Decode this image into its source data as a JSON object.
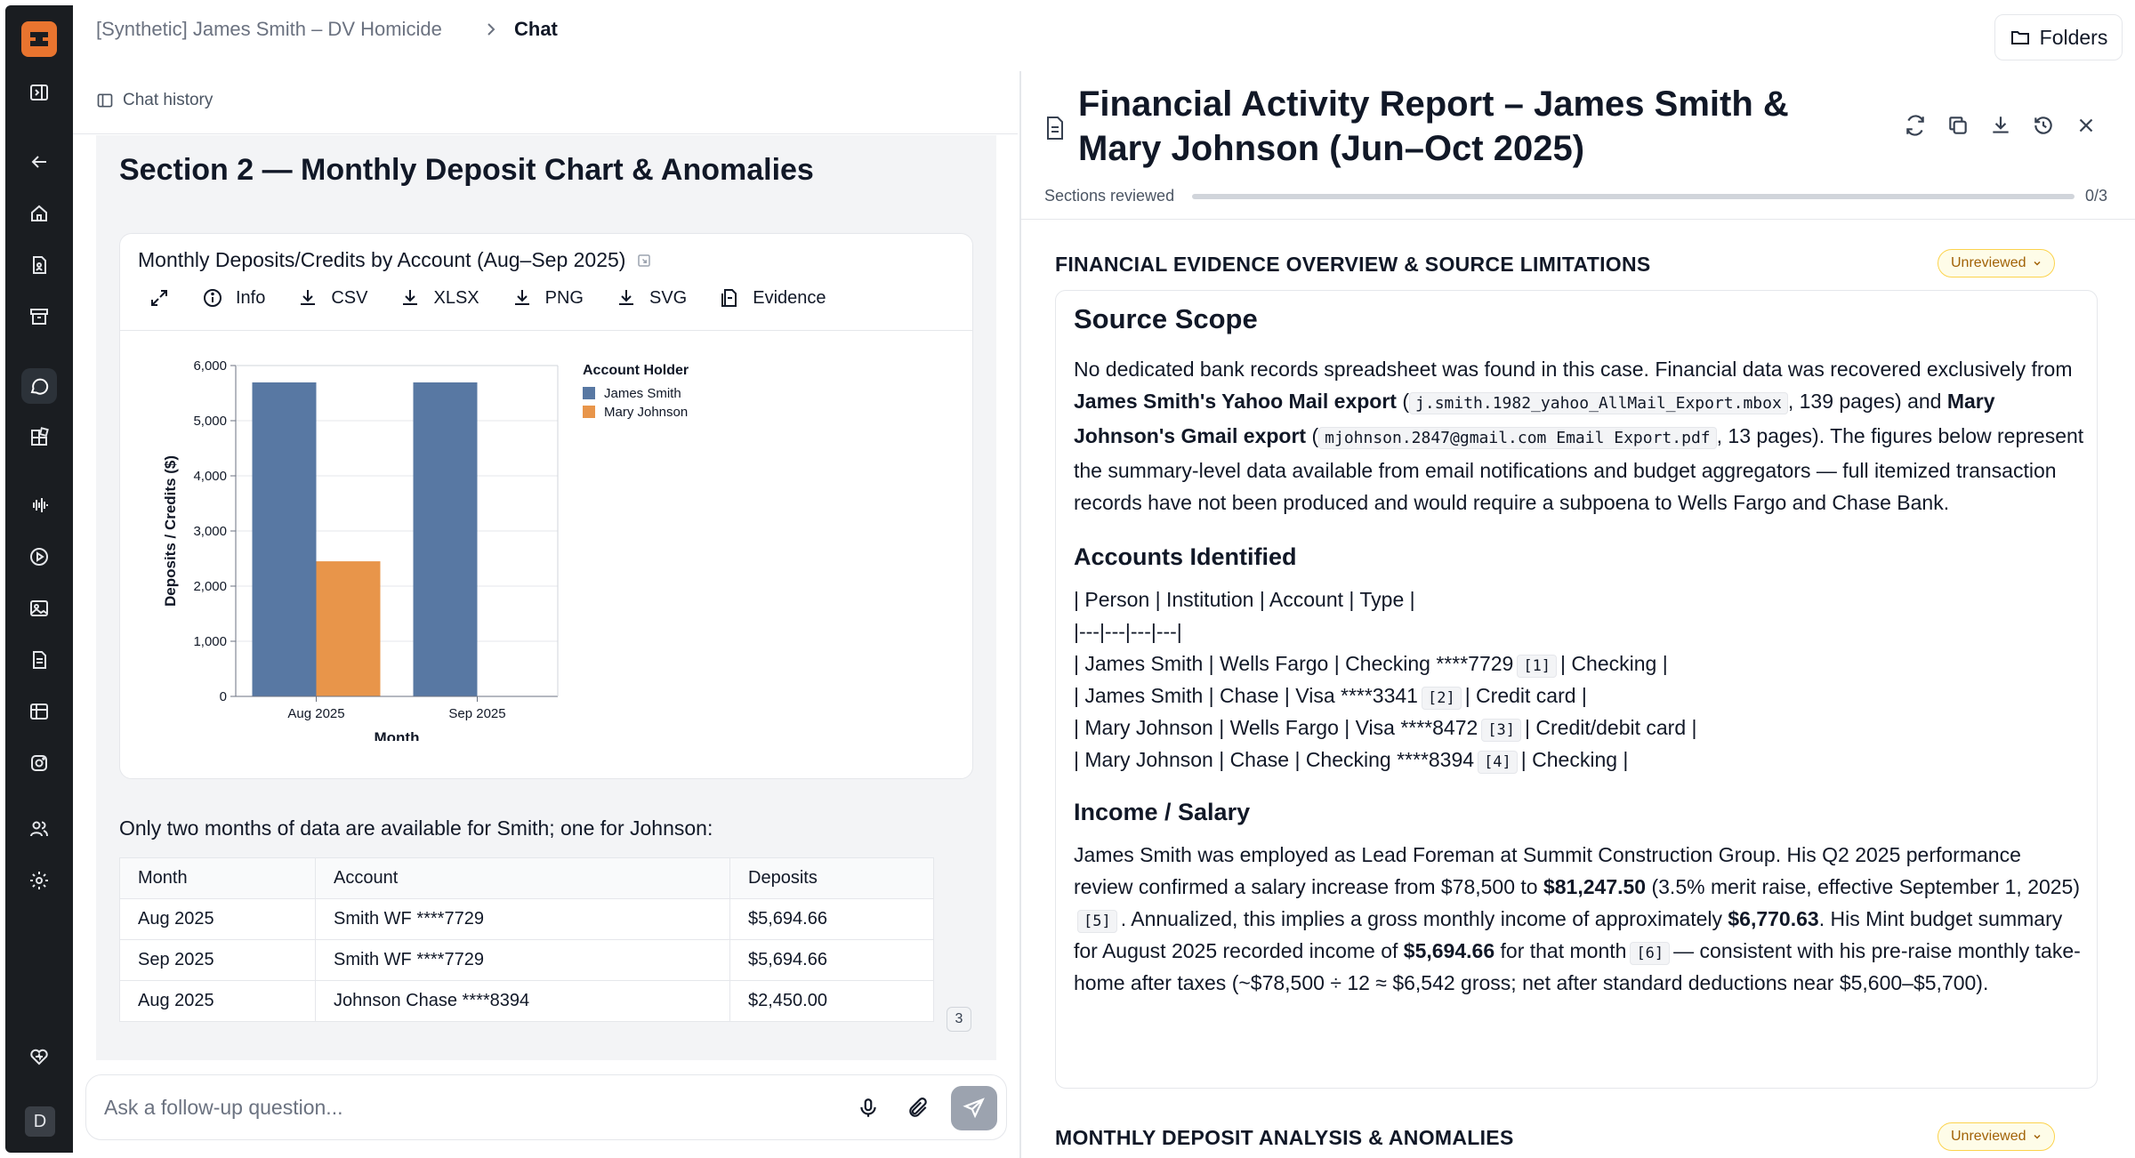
{
  "breadcrumb": {
    "case": "[Synthetic] James Smith – DV Homicide",
    "current": "Chat"
  },
  "header": {
    "folders_label": "Folders"
  },
  "chat": {
    "history_label": "Chat history",
    "section_title": "Section 2 — Monthly Deposit Chart & Anomalies",
    "chart_card": {
      "title": "Monthly Deposits/Credits by Account (Aug–Sep 2025)",
      "toolbar": {
        "info": "Info",
        "csv": "CSV",
        "xlsx": "XLSX",
        "png": "PNG",
        "svg": "SVG",
        "evidence": "Evidence"
      }
    },
    "caption": "Only two months of data are available for Smith; one for Johnson:",
    "table": {
      "headers": [
        "Month",
        "Account",
        "Deposits"
      ],
      "rows": [
        [
          "Aug 2025",
          "Smith WF ****7729",
          "$5,694.66"
        ],
        [
          "Sep 2025",
          "Smith WF ****7729",
          "$5,694.66"
        ],
        [
          "Aug 2025",
          "Johnson Chase ****8394",
          "$2,450.00"
        ]
      ]
    },
    "page_badge": "3",
    "composer": {
      "placeholder": "Ask a follow-up question..."
    }
  },
  "chart_data": {
    "type": "bar",
    "categories": [
      "Aug 2025",
      "Sep 2025"
    ],
    "series": [
      {
        "name": "James Smith",
        "values": [
          5694.66,
          5694.66
        ],
        "color": "#5878a3"
      },
      {
        "name": "Mary Johnson",
        "values": [
          2450.0,
          null
        ],
        "color": "#e8954a"
      }
    ],
    "xlabel": "Month",
    "ylabel": "Deposits / Credits ($)",
    "ylim": [
      0,
      6000
    ],
    "yticks": [
      0,
      1000,
      2000,
      3000,
      4000,
      5000,
      6000
    ],
    "ytick_labels": [
      "0",
      "1,000",
      "2,000",
      "3,000",
      "4,000",
      "5,000",
      "6,000"
    ],
    "legend_title": "Account Holder",
    "legend_position": "right",
    "grid": true
  },
  "report": {
    "title": "Financial Activity Report – James Smith & Mary Johnson (Jun–Oct 2025)",
    "progress": {
      "label": "Sections reviewed",
      "count": "0/3",
      "done": 0,
      "total": 3
    },
    "sections": [
      {
        "heading": "FINANCIAL EVIDENCE OVERVIEW & SOURCE LIMITATIONS",
        "badge": "Unreviewed"
      },
      {
        "heading": "MONTHLY DEPOSIT ANALYSIS & ANOMALIES",
        "badge": "Unreviewed"
      }
    ],
    "source_scope": {
      "heading": "Source Scope",
      "t1": "No dedicated bank records spreadsheet was found in this case. Financial data was recovered exclusively from ",
      "b1": "James Smith's Yahoo Mail export",
      "t2": " (",
      "c1": "j.smith.1982_yahoo_AllMail_Export.mbox",
      "t3": ", 139 pages) and ",
      "b2": "Mary Johnson's Gmail export",
      "t4": " (",
      "c2": "mjohnson.2847@gmail.com Email Export.pdf",
      "t5": ", 13 pages). The figures below represent the summary-level data available from email notifications and budget aggregators — full itemized transaction records have not been produced and would require a subpoena to Wells Fargo and Chase Bank."
    },
    "accounts": {
      "heading": "Accounts Identified",
      "header_row": "| Person | Institution | Account | Type |",
      "sep_row": "|---|---|---|---|",
      "rows": [
        {
          "pre": "| James Smith | Wells Fargo | Checking ****7729",
          "cite": "[1]",
          "post": "| Checking |"
        },
        {
          "pre": "| James Smith | Chase | Visa ****3341",
          "cite": "[2]",
          "post": "| Credit card |"
        },
        {
          "pre": "| Mary Johnson | Wells Fargo | Visa ****8472",
          "cite": "[3]",
          "post": "| Credit/debit card |"
        },
        {
          "pre": "| Mary Johnson | Chase | Checking ****8394",
          "cite": "[4]",
          "post": "| Checking |"
        }
      ]
    },
    "income": {
      "heading": "Income / Salary",
      "t1": "James Smith was employed as Lead Foreman at Summit Construction Group. His Q2 2025 performance review confirmed a salary increase from $78,500 to ",
      "b1": "$81,247.50",
      "t2": " (3.5% merit raise, effective September 1, 2025)",
      "cite1": "[5]",
      "t3": ". Annualized, this implies a gross monthly income of approximately ",
      "b2": "$6,770.63",
      "t4": ". His Mint budget summary for August 2025 recorded income of ",
      "b3": "$5,694.66",
      "t5": " for that month",
      "cite2": "[6]",
      "t6": "— consistent with his pre-raise monthly take-home after taxes (~$78,500 ÷ 12 ≈ $6,542 gross; net after standard deductions near $5,600–$5,700)."
    }
  },
  "rail": {
    "avatar": "D"
  }
}
